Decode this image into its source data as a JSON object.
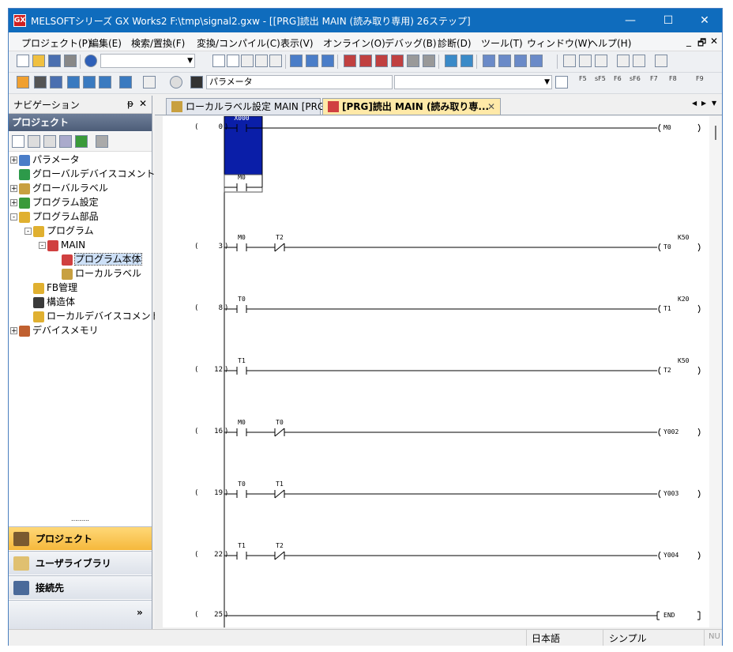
{
  "window": {
    "title": "MELSOFTシリーズ GX Works2 F:\\tmp\\signal2.gxw - [[PRG]読出 MAIN (読み取り専用) 26ステップ]",
    "app_icon_text": "GX",
    "minimize": "—",
    "maximize": "☐",
    "close": "✕"
  },
  "menu": {
    "items": [
      "プロジェクト(P)",
      "編集(E)",
      "検索/置換(F)",
      "変換/コンパイル(C)",
      "表示(V)",
      "オンライン(O)",
      "デバッグ(B)",
      "診断(D)",
      "ツール(T)",
      "ウィンドウ(W)",
      "ヘルプ(H)"
    ],
    "mdi_min": "_",
    "mdi_restore": "🗗",
    "mdi_close": "✕"
  },
  "toolbar2": {
    "combo_value": "パラメータ"
  },
  "fkeys": [
    "F5",
    "sF5",
    "F6",
    "sF6",
    "F7",
    "F8",
    "F9"
  ],
  "navigation": {
    "title": "ナビゲーション",
    "pin": "ᵽ",
    "close": "✕",
    "project_header": "プロジェクト",
    "tree": [
      {
        "label": "パラメータ",
        "level": 0,
        "expander": "+",
        "color": "#4a7dc8"
      },
      {
        "label": "グローバルデバイスコメント",
        "level": 0,
        "expander": "",
        "color": "#2d9a4a"
      },
      {
        "label": "グローバルラベル",
        "level": 0,
        "expander": "+",
        "color": "#c8a040"
      },
      {
        "label": "プログラム設定",
        "level": 0,
        "expander": "+",
        "color": "#3a9a3a"
      },
      {
        "label": "プログラム部品",
        "level": 0,
        "expander": "-",
        "color": "#e0b030"
      },
      {
        "label": "プログラム",
        "level": 1,
        "expander": "-",
        "color": "#e0b030"
      },
      {
        "label": "MAIN",
        "level": 2,
        "expander": "-",
        "color": "#d04040"
      },
      {
        "label": "プログラム本体",
        "level": 3,
        "expander": "",
        "color": "#d04040"
      },
      {
        "label": "ローカルラベル",
        "level": 3,
        "expander": "",
        "color": "#c8a040"
      },
      {
        "label": "FB管理",
        "level": 1,
        "expander": "",
        "color": "#e0b030"
      },
      {
        "label": "構造体",
        "level": 1,
        "expander": "",
        "color": "#3a3a3a"
      },
      {
        "label": "ローカルデバイスコメント",
        "level": 1,
        "expander": "",
        "color": "#e0b030"
      },
      {
        "label": "デバイスメモリ",
        "level": 0,
        "expander": "+",
        "color": "#c06030"
      }
    ],
    "bottom_buttons": [
      "プロジェクト",
      "ユーザライブラリ",
      "接続先"
    ],
    "expand_glyph": "»",
    "grip": "........."
  },
  "tabs": [
    {
      "label": "ローカルラベル設定 MAIN [PRG]",
      "active": false
    },
    {
      "label": "[PRG]読出 MAIN (読み取り専...",
      "active": true
    }
  ],
  "tab_nav": {
    "left": "◀",
    "right": "▶",
    "menu": "▼",
    "close": "✕"
  },
  "ladder": {
    "rows": [
      {
        "step": "0",
        "contacts": [
          {
            "dev": "X000",
            "type": "NO"
          }
        ],
        "coil": "M0",
        "k": "",
        "branch": {
          "dev": "M0",
          "type": "NO"
        }
      },
      {
        "step": "3",
        "contacts": [
          {
            "dev": "M0",
            "type": "NO"
          },
          {
            "dev": "T2",
            "type": "NC"
          }
        ],
        "coil": "T0",
        "k": "K50"
      },
      {
        "step": "8",
        "contacts": [
          {
            "dev": "T0",
            "type": "NO"
          }
        ],
        "coil": "T1",
        "k": "K20"
      },
      {
        "step": "12",
        "contacts": [
          {
            "dev": "T1",
            "type": "NO"
          }
        ],
        "coil": "T2",
        "k": "K50"
      },
      {
        "step": "16",
        "contacts": [
          {
            "dev": "M0",
            "type": "NO"
          },
          {
            "dev": "T0",
            "type": "NC"
          }
        ],
        "coil": "Y002",
        "k": ""
      },
      {
        "step": "19",
        "contacts": [
          {
            "dev": "T0",
            "type": "NO"
          },
          {
            "dev": "T1",
            "type": "NC"
          }
        ],
        "coil": "Y003",
        "k": ""
      },
      {
        "step": "22",
        "contacts": [
          {
            "dev": "T1",
            "type": "NO"
          },
          {
            "dev": "T2",
            "type": "NC"
          }
        ],
        "coil": "Y004",
        "k": ""
      },
      {
        "step": "25",
        "contacts": [],
        "coil": "END",
        "k": "",
        "end": true
      }
    ]
  },
  "status": {
    "language": "日本語",
    "mode": "シンプル",
    "numlock": "NU"
  }
}
